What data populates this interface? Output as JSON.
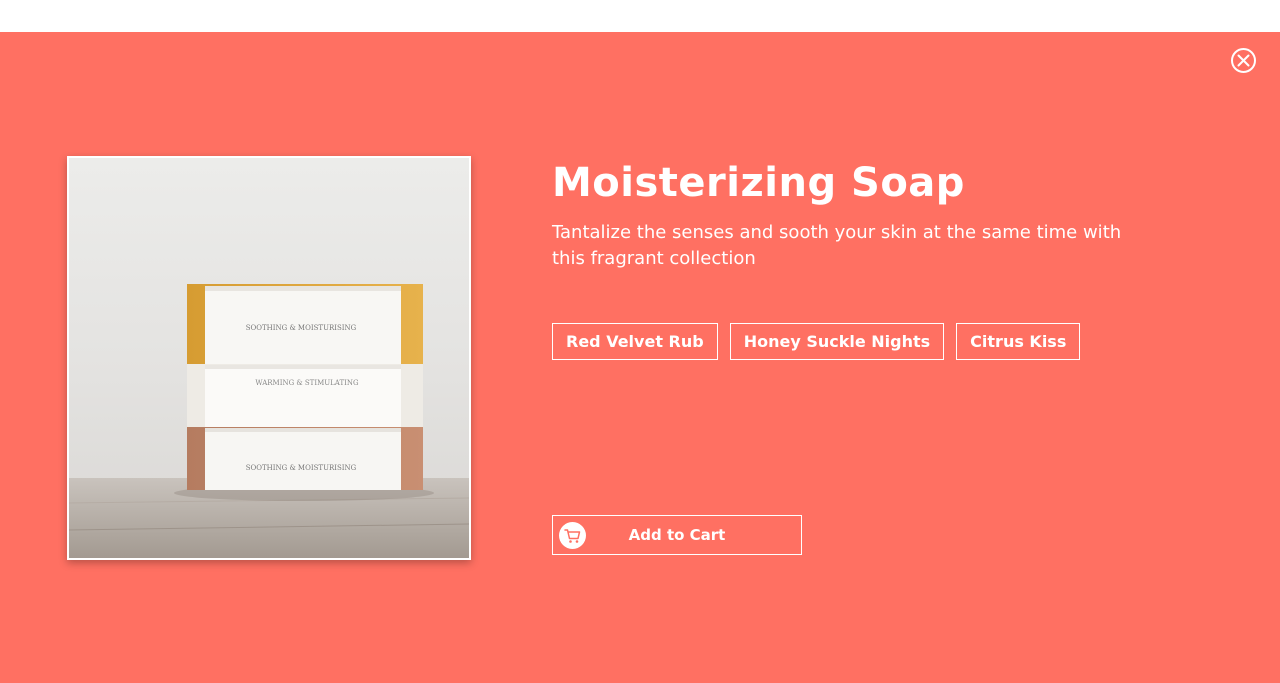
{
  "modal": {
    "background_color": "#ff7062",
    "close_icon": "close-circle-icon"
  },
  "product": {
    "title": "Moisterizing Soap",
    "description": "Tantalize the senses and sooth your skin at the same time with this fragrant collection",
    "image": {
      "soap_labels": [
        "SOOTHING & MOISTURISING",
        "WARMING & STIMULATING",
        "SOOTHING & MOISTURISING"
      ]
    },
    "variants": [
      "Red Velvet Rub",
      "Honey Suckle Nights",
      "Citrus Kiss"
    ]
  },
  "cart": {
    "label": "Add to Cart",
    "icon": "cart-icon"
  }
}
